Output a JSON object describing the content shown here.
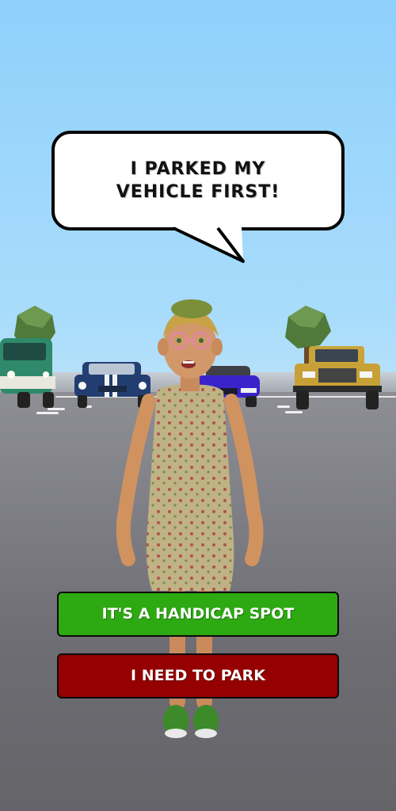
{
  "dialogue": {
    "speech_line1": "I PARKED MY",
    "speech_line2": "VEHICLE FIRST!"
  },
  "choices": [
    {
      "label": "IT'S A HANDICAP SPOT",
      "color": "#2da912"
    },
    {
      "label": "I NEED TO PARK",
      "color": "#950000"
    }
  ],
  "scene": {
    "sky_color": "#a9dcfb",
    "ground_color": "#6d6d73",
    "vehicles": [
      {
        "name": "green-van",
        "color": "#2e8a6a"
      },
      {
        "name": "blue-muscle-car",
        "color": "#233f73"
      },
      {
        "name": "purple-sports-car",
        "color": "#3a24c9"
      },
      {
        "name": "yellow-suv",
        "color": "#c9a43a"
      }
    ]
  }
}
